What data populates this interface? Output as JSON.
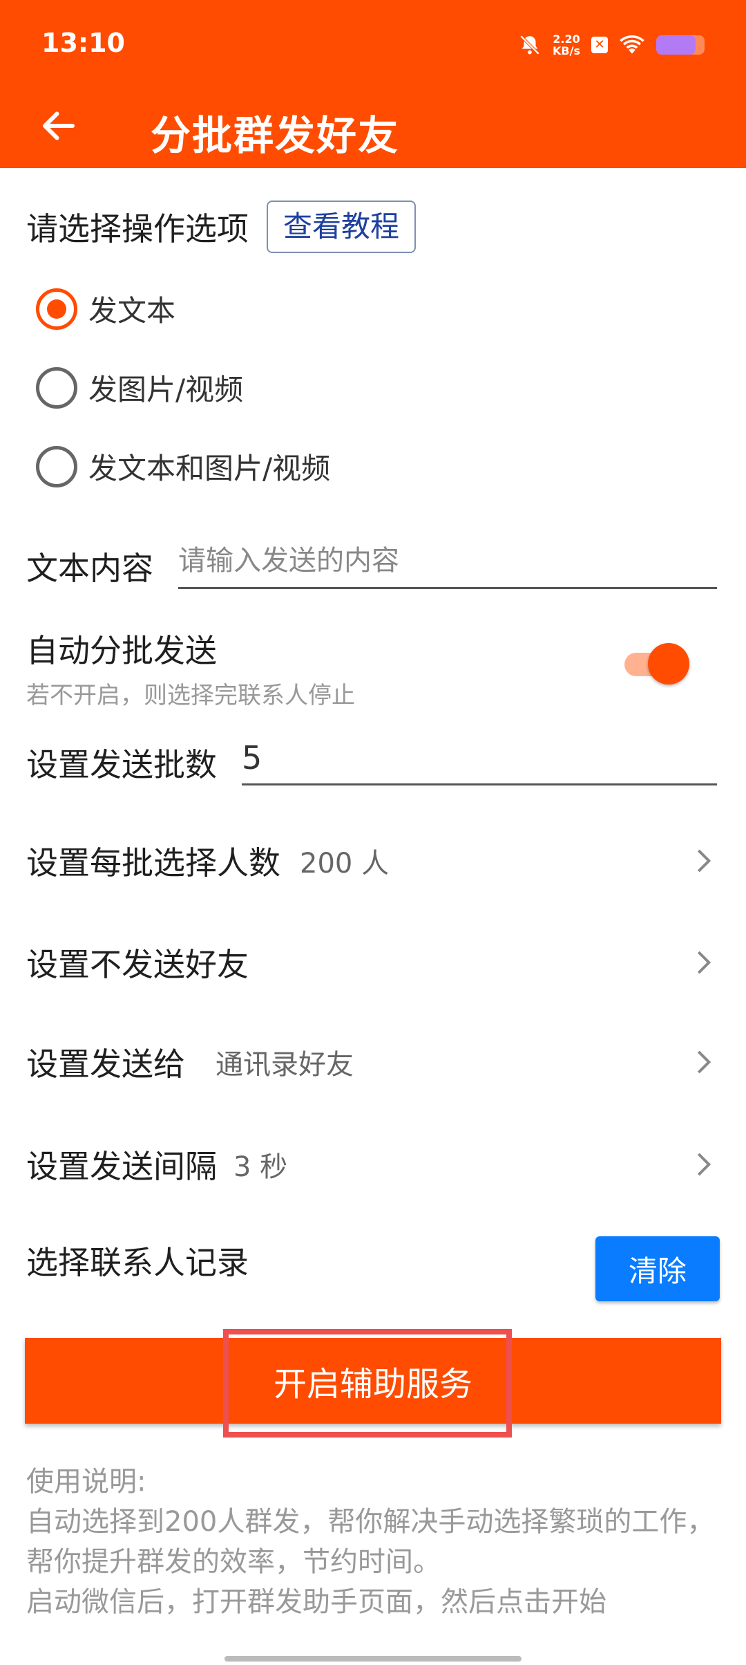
{
  "status_bar": {
    "time": "13:10",
    "net_speed_value": "2.20",
    "net_speed_unit": "KB/s",
    "battery_level": 0.82,
    "icons": [
      "mute-icon",
      "sim-icon",
      "wifi-icon",
      "battery-icon"
    ]
  },
  "app_bar": {
    "title": "分批群发好友",
    "back_icon": "arrow-left-icon"
  },
  "options": {
    "label": "请选择操作选项",
    "tutorial_button": "查看教程",
    "radios": [
      {
        "label": "发文本",
        "selected": true
      },
      {
        "label": "发图片/视频",
        "selected": false
      },
      {
        "label": "发文本和图片/视频",
        "selected": false
      }
    ]
  },
  "text_content": {
    "label": "文本内容",
    "value": "",
    "placeholder": "请输入发送的内容"
  },
  "auto_batch": {
    "title": "自动分批发送",
    "subtitle": "若不开启，则选择完联系人停止",
    "enabled": true
  },
  "batch_count": {
    "label": "设置发送批数",
    "value": "5"
  },
  "nav_rows": [
    {
      "label": "设置每批选择人数",
      "value": "200 人"
    },
    {
      "label": "设置不发送好友",
      "value": ""
    },
    {
      "label": "设置发送给",
      "value": "通讯录好友"
    },
    {
      "label": "设置发送间隔",
      "value": "3 秒"
    }
  ],
  "contacts": {
    "label": "选择联系人记录",
    "clear_button": "清除"
  },
  "main_button": {
    "label": "开启辅助服务"
  },
  "instructions": {
    "title": "使用说明:",
    "lines": [
      "自动选择到200人群发，帮你解决手动选择繁琐的工作，帮你提升群发的效率，节约时间。",
      "启动微信后，打开群发助手页面，然后点击开始"
    ]
  },
  "colors": {
    "primary": "#ff4c00",
    "accent_blue": "#0a7cff",
    "link_blue": "#1e40a0",
    "highlight_red": "#ee4f4f"
  }
}
